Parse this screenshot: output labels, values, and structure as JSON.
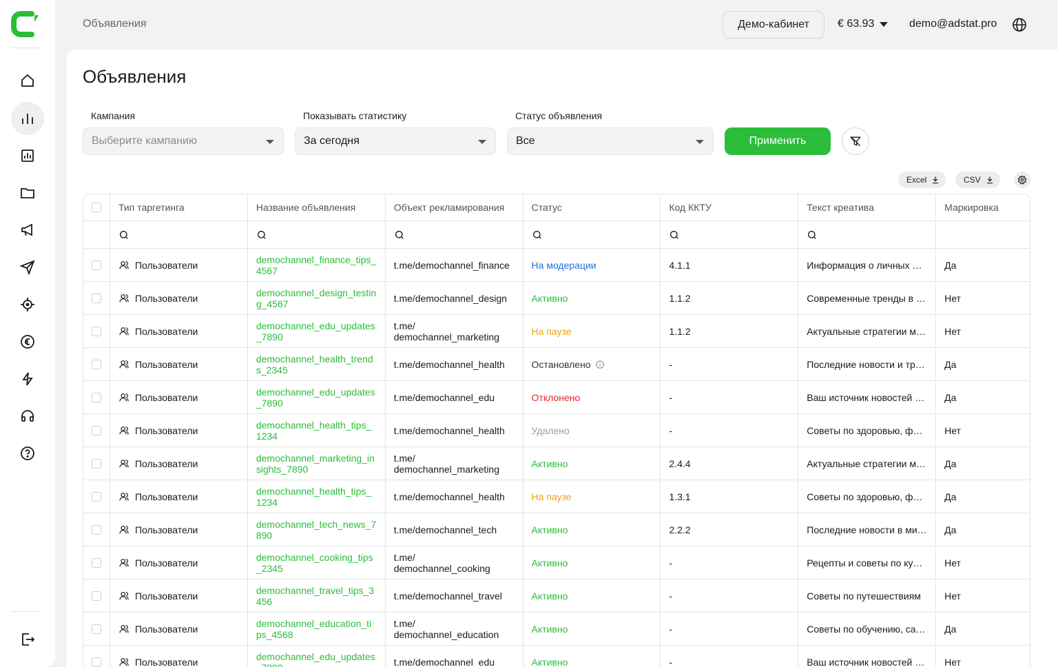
{
  "header": {
    "breadcrumb": "Объявления",
    "demo_button": "Демо-кабинет",
    "balance": "€ 63.93",
    "email": "demo@adstat.pro"
  },
  "page": {
    "title": "Объявления"
  },
  "filters": {
    "campaign": {
      "label": "Кампания",
      "placeholder": "Выберите кампанию"
    },
    "stats": {
      "label": "Показывать статистику",
      "value": "За сегодня"
    },
    "status": {
      "label": "Статус объявления",
      "value": "Все"
    },
    "apply": "Применить"
  },
  "export": {
    "excel": "Excel",
    "csv": "CSV"
  },
  "table": {
    "headers": [
      "Тип таргетинга",
      "Название объявления",
      "Объект рекламирования",
      "Статус",
      "Код ККТУ",
      "Текст креатива",
      "Маркировка"
    ],
    "rows": [
      {
        "type": "Пользователи",
        "name": "demochannel_finance_tips_4567",
        "object": "t.me/demochannel_finance",
        "status": "На модерации",
        "status_color": "#1f6fe0",
        "kktu": "4.1.1",
        "text": "Информация о личных финансах",
        "mark": "Да"
      },
      {
        "type": "Пользователи",
        "name": "demochannel_design_testing_4567",
        "object": "t.me/demochannel_design",
        "status": "Активно",
        "status_color": "#2bbd3a",
        "kktu": "1.1.2",
        "text": "Современные тренды в дизайне",
        "mark": "Нет"
      },
      {
        "type": "Пользователи",
        "name": "demochannel_edu_updates_7890",
        "object": "t.me/ demochannel_marketing",
        "status": "На паузе",
        "status_color": "#f0a30a",
        "kktu": "1.1.2",
        "text": "Актуальные стратегии маркетинга",
        "mark": "Нет"
      },
      {
        "type": "Пользователи",
        "name": "demochannel_health_trends_2345",
        "object": "t.me/demochannel_health",
        "status": "Остановлено",
        "status_color": "#333333",
        "kktu": "-",
        "text": "Последние новости и тренды",
        "mark": "Да"
      },
      {
        "type": "Пользователи",
        "name": "demochannel_edu_updates_7890",
        "object": "t.me/demochannel_edu",
        "status": "Отклонено",
        "status_color": "#e02424",
        "kktu": "-",
        "text": "Ваш источник новостей образования",
        "mark": "Да"
      },
      {
        "type": "Пользователи",
        "name": "demochannel_health_tips_1234",
        "object": "t.me/demochannel_health",
        "status": "Удалено",
        "status_color": "#9a9a9a",
        "kktu": "-",
        "text": "Советы по здоровью, фитнесу",
        "mark": "Нет"
      },
      {
        "type": "Пользователи",
        "name": "demochannel_marketing_insights_7890",
        "object": "t.me/ demochannel_marketing",
        "status": "Активно",
        "status_color": "#2bbd3a",
        "kktu": "2.4.4",
        "text": "Актуальные стратегии маркетинга",
        "mark": "Да"
      },
      {
        "type": "Пользователи",
        "name": "demochannel_health_tips_1234",
        "object": "t.me/demochannel_health",
        "status": "На паузе",
        "status_color": "#f0a30a",
        "kktu": "1.3.1",
        "text": "Советы по здоровью, фитнесу",
        "mark": "Да"
      },
      {
        "type": "Пользователи",
        "name": "demochannel_tech_news_7890",
        "object": "t.me/demochannel_tech",
        "status": "Активно",
        "status_color": "#2bbd3a",
        "kktu": "2.2.2",
        "text": "Последние новости в мире технологий",
        "mark": "Да"
      },
      {
        "type": "Пользователи",
        "name": "demochannel_cooking_tips_2345",
        "object": "t.me/ demochannel_cooking",
        "status": "Активно",
        "status_color": "#2bbd3a",
        "kktu": "-",
        "text": "Рецепты и советы по кулинарии",
        "mark": "Нет"
      },
      {
        "type": "Пользователи",
        "name": "demochannel_travel_tips_3456",
        "object": "t.me/demochannel_travel",
        "status": "Активно",
        "status_color": "#2bbd3a",
        "kktu": "-",
        "text": "Советы по путешествиям",
        "mark": "Нет"
      },
      {
        "type": "Пользователи",
        "name": "demochannel_education_tips_4568",
        "object": "t.me/ demochannel_education",
        "status": "Активно",
        "status_color": "#2bbd3a",
        "kktu": "-",
        "text": "Советы по обучению, саморазвитию",
        "mark": "Да"
      },
      {
        "type": "Пользователи",
        "name": "demochannel_edu_updates_7890",
        "object": "t.me/demochannel_edu",
        "status": "Активно",
        "status_color": "#2bbd3a",
        "kktu": "-",
        "text": "Ваш источник новостей образования",
        "mark": "Нет"
      }
    ]
  },
  "colors": {
    "accent": "#2bbd3a",
    "background": "#f2f2f2"
  }
}
